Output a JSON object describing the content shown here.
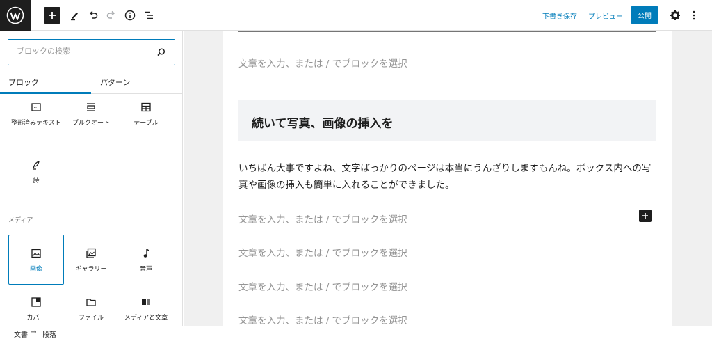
{
  "toolbar": {
    "draft_label": "下書き保存",
    "preview_label": "プレビュー",
    "publish_label": "公開"
  },
  "sidebar": {
    "search": {
      "placeholder": "ブロックの検索",
      "value": ""
    },
    "tabs": [
      "ブロック",
      "パターン"
    ],
    "blocks_text": [
      {
        "label": "整形済みテキスト",
        "icon": "preformatted-icon"
      },
      {
        "label": "プルクオート",
        "icon": "pullquote-icon"
      },
      {
        "label": "テーブル",
        "icon": "table-icon"
      },
      {
        "label": "詩",
        "icon": "verse-icon"
      }
    ],
    "media_section_label": "メディア",
    "blocks_media": [
      {
        "label": "画像",
        "icon": "image-icon",
        "selected": true
      },
      {
        "label": "ギャラリー",
        "icon": "gallery-icon"
      },
      {
        "label": "音声",
        "icon": "audio-icon"
      },
      {
        "label": "カバー",
        "icon": "cover-icon"
      },
      {
        "label": "ファイル",
        "icon": "file-icon"
      },
      {
        "label": "メディアと文章",
        "icon": "media-text-icon"
      }
    ]
  },
  "editor": {
    "placeholder": "文章を入力、または / でブロックを選択",
    "heading": "続いて写真、画像の挿入を",
    "paragraph_line1": "いちばん大事ですよね、文字ばっかりのページは本当にうんざりしますもんね。ボックス内への写",
    "paragraph_line2": "真や画像の挿入も簡単に入れることができました。"
  },
  "breadcrumb": {
    "items": [
      "文書",
      "段落"
    ],
    "separator": "→"
  },
  "colors": {
    "accent": "#007cba",
    "dark": "#1e1e1e"
  }
}
